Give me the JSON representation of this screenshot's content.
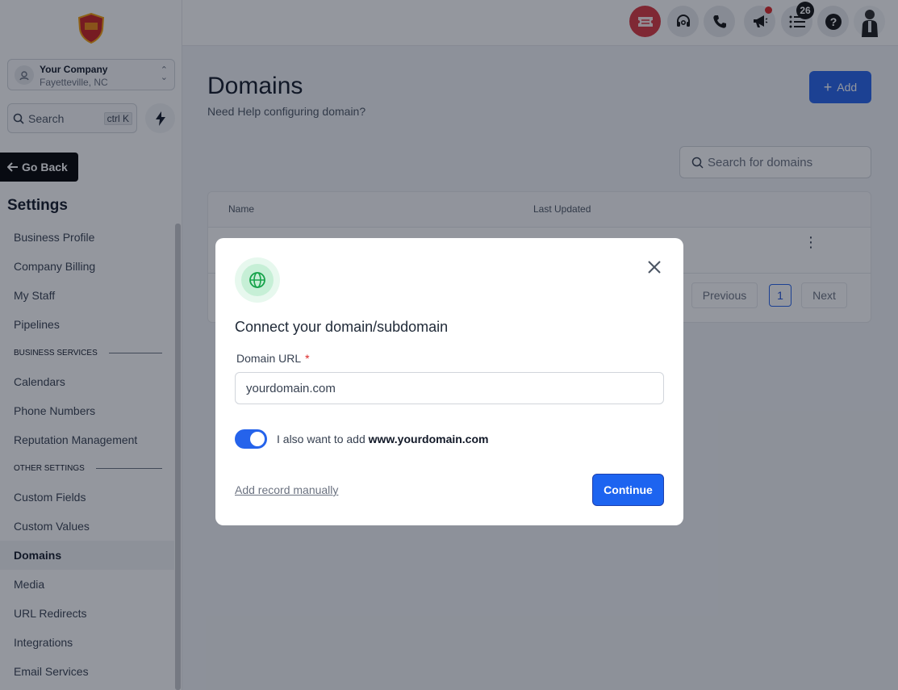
{
  "sidebar": {
    "logo_icon": "shield-logo-icon",
    "company": {
      "name": "Your Company",
      "location": "Fayetteville, NC"
    },
    "search": {
      "label": "Search",
      "shortcut": "ctrl K"
    },
    "go_back": "Go Back",
    "settings_title": "Settings",
    "items_top": [
      "Business Profile",
      "Company Billing",
      "My Staff",
      "Pipelines"
    ],
    "section_business": "BUSINESS SERVICES",
    "items_business": [
      "Calendars",
      "Phone Numbers",
      "Reputation Management"
    ],
    "section_other": "OTHER SETTINGS",
    "items_other": [
      "Custom Fields",
      "Custom Values",
      "Domains",
      "Media",
      "URL Redirects",
      "Integrations",
      "Email Services"
    ],
    "active_item": "Domains"
  },
  "topbar": {
    "icons": [
      "ticket-icon",
      "headset-icon",
      "phone-icon",
      "megaphone-icon",
      "task-list-icon",
      "help-icon",
      "user-avatar"
    ],
    "notifications_count": "26",
    "colors": {
      "ticket_bg": "#d9363e"
    }
  },
  "main": {
    "title": "Domains",
    "help_text": "Need Help configuring domain?",
    "add_label": "Add",
    "search_placeholder": "Search for domains",
    "table": {
      "columns": [
        "Name",
        "Last Updated"
      ]
    },
    "pagination": {
      "previous": "Previous",
      "current": "1",
      "next": "Next"
    }
  },
  "modal": {
    "icon": "globe-icon",
    "title": "Connect your domain/subdomain",
    "field_label": "Domain URL",
    "required_mark": "*",
    "field_value": "yourdomain.com",
    "toggle_on": true,
    "toggle_text": "I also want to add",
    "toggle_bold": "www.yourdomain.com",
    "manual_link": "Add record manually",
    "continue_label": "Continue"
  },
  "colors": {
    "primary": "#2563eb",
    "globe": "#16a34a"
  }
}
